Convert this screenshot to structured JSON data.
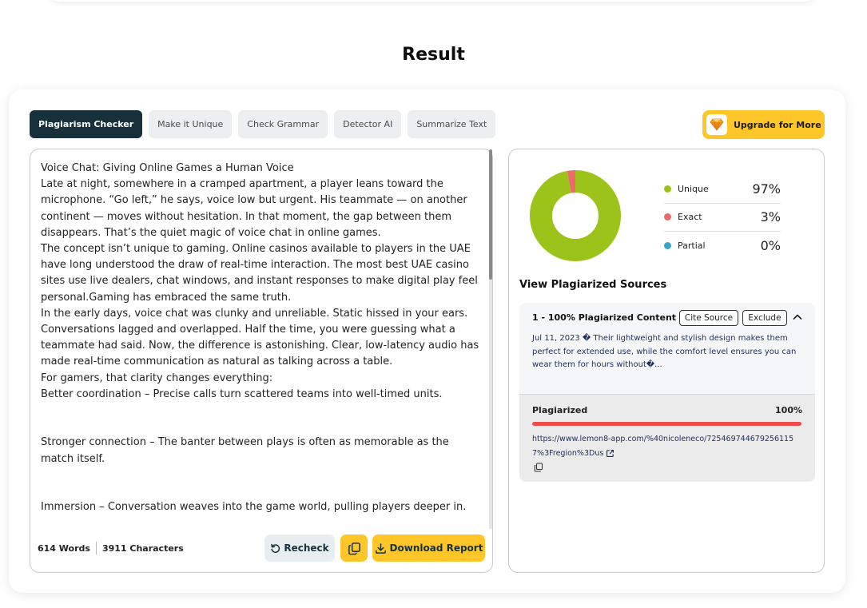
{
  "page": {
    "title": "Result"
  },
  "tabs": [
    {
      "label": "Plagiarism Checker",
      "active": true
    },
    {
      "label": "Make it Unique",
      "active": false
    },
    {
      "label": "Check Grammar",
      "active": false
    },
    {
      "label": "Detector AI",
      "active": false
    },
    {
      "label": "Summarize Text",
      "active": false
    }
  ],
  "upgrade": {
    "label": "Upgrade for More",
    "icon": "gem-icon",
    "color": "#ffc629"
  },
  "editor": {
    "paragraphs": [
      "Voice Chat: Giving Online Games a Human Voice",
      "Late at night, somewhere in a cramped apartment, a player leans toward the microphone. “Go left,” he says, voice low but urgent. His teammate — on another continent — moves without hesitation. In that moment, the gap between them disappears. That’s the quiet magic of voice chat in online games.",
      "The concept isn’t unique to gaming. Online casinos available to players in the UAE have long understood the draw of real-time interaction. The most best UAE casino sites use live dealers, chat windows, and instant responses to make digital play feel personal.Gaming has embraced the same truth.",
      "In the early days, voice chat was clunky and unreliable. Static hissed in your ears. Conversations lagged and overlapped. Half the time, you were guessing what a teammate had said. Now, the difference is astonishing. Clear, low-latency audio has made real-time communication as natural as talking across a table.",
      "For gamers, that clarity changes everything:",
      "Better coordination – Precise calls turn scattered teams into well-timed units.",
      "",
      "Stronger connection – The banter between plays is often as memorable as the match itself.",
      "",
      "Immersion – Conversation weaves into the game world, pulling players deeper in."
    ],
    "words": "614 Words",
    "characters": "3911 Characters",
    "recheck_label": "Recheck",
    "download_label": "Download Report"
  },
  "results": {
    "legend": [
      {
        "label": "Unique",
        "value": "97%",
        "color": "#9bc31a"
      },
      {
        "label": "Exact",
        "value": "3%",
        "color": "#ee6a6a"
      },
      {
        "label": "Partial",
        "value": "0%",
        "color": "#3aa3c9"
      }
    ],
    "donut": {
      "unique": 97,
      "exact": 3,
      "partial": 0
    },
    "sources_title": "View Plagiarized Sources",
    "source": {
      "heading": "1 - 100% Plagiarized Content",
      "cite_label": "Cite Source",
      "exclude_label": "Exclude",
      "snippet": "Jul 11, 2023 � Their lightweight and stylish design makes them perfect for extended use, while the comfort level ensures you can wear them for hours without�...",
      "plag_label": "Plagiarized",
      "plag_value": "100%",
      "plag_fraction": 1.0,
      "url": "https://www.lemon8-app.com/%40nicoleneco/7254697446792561157%3Fregion%3Dus"
    }
  }
}
